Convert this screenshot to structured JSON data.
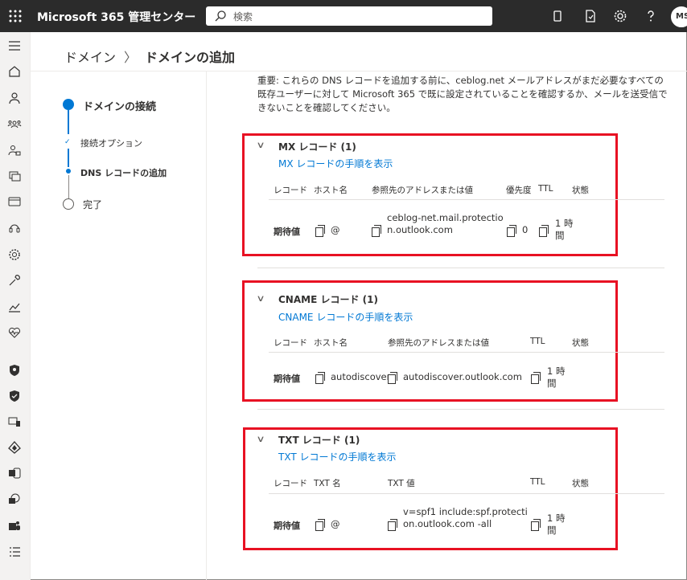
{
  "topbar": {
    "title": "Microsoft 365 管理センター",
    "search_placeholder": "検索",
    "avatar_initials": "MS"
  },
  "breadcrumb": {
    "parent": "ドメイン",
    "current": "ドメインの追加"
  },
  "stepper": {
    "steps": [
      {
        "label": "ドメインの接続"
      },
      {
        "label": "接続オプション"
      },
      {
        "label": "DNS レコードの追加"
      },
      {
        "label": "完了"
      }
    ]
  },
  "notice": "重要: これらの DNS レコードを追加する前に、ceblog.net メールアドレスがまだ必要なすべての既存ユーザーに対して Microsoft 365 で既に設定されていることを確認するか、メールを送受信できないことを確認してください。",
  "mx": {
    "title": "MX レコード (1)",
    "link": "MX レコードの手順を表示",
    "headers": {
      "record": "レコード",
      "host": "ホスト名",
      "target": "参照先のアドレスまたは値",
      "priority": "優先度",
      "ttl": "TTL",
      "status": "状態"
    },
    "row": {
      "record": "期待値",
      "host": "@",
      "target": "ceblog-net.mail.protection.outlook.com",
      "priority": "0",
      "ttl": "1 時間"
    }
  },
  "cname": {
    "title": "CNAME レコード (1)",
    "link": "CNAME レコードの手順を表示",
    "headers": {
      "record": "レコード",
      "host": "ホスト名",
      "target": "参照先のアドレスまたは値",
      "ttl": "TTL",
      "status": "状態"
    },
    "row": {
      "record": "期待値",
      "host": "autodiscover",
      "target": "autodiscover.outlook.com",
      "ttl": "1 時間"
    }
  },
  "txt": {
    "title": "TXT レコード (1)",
    "link": "TXT レコードの手順を表示",
    "headers": {
      "record": "レコード",
      "name": "TXT 名",
      "value": "TXT 値",
      "ttl": "TTL",
      "status": "状態"
    },
    "row": {
      "record": "期待値",
      "name": "@",
      "value": "v=spf1 include:spf.protection.outlook.com -all",
      "ttl": "1 時間"
    }
  },
  "colors": {
    "accent": "#0078d4",
    "highlight": "#e81123",
    "topbar": "#2b2b2b"
  }
}
